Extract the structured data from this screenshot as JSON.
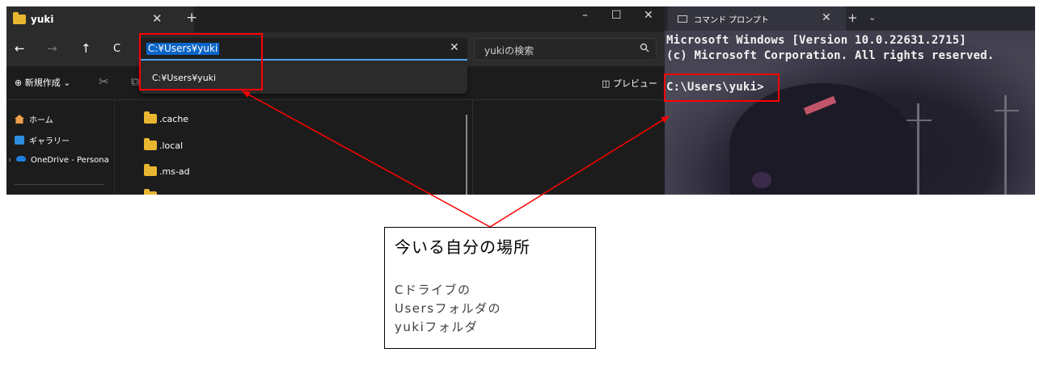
{
  "explorer": {
    "tab_title": "yuki",
    "tab_close": "✕",
    "tab_add": "+",
    "window_controls": {
      "minimize": "–",
      "maximize": "☐",
      "close": "✕"
    },
    "nav": {
      "back": "←",
      "forward": "→",
      "up": "↑",
      "refresh": "C"
    },
    "address": {
      "value": "C:¥Users¥yuki",
      "clear": "✕"
    },
    "search": {
      "placeholder": "yukiの検索",
      "icon": "search-icon"
    },
    "toolbar": {
      "new_label": "⊕ 新規作成 ⌄",
      "cut": "✂",
      "copy": "⧉",
      "preview_label": "◫ プレビュー"
    },
    "dropdown": {
      "item": "C:¥Users¥yuki"
    },
    "sidebar": [
      {
        "label": "ホーム",
        "icon": "home-icon"
      },
      {
        "label": "ギャラリー",
        "icon": "gallery-icon"
      },
      {
        "label": "OneDrive - Persona",
        "icon": "cloud-icon",
        "expander": "›"
      }
    ],
    "files": [
      ".cache",
      ".local",
      ".ms-ad"
    ]
  },
  "cmd": {
    "tab_title": "コマンド プロンプト",
    "tab_close": "✕",
    "tab_add": "+",
    "tab_menu": "⌄",
    "lines": [
      "Microsoft Windows [Version 10.0.22631.2715]",
      "(c) Microsoft Corporation. All rights reserved.",
      "C:\\Users\\yuki>"
    ]
  },
  "annotation": {
    "title": "今いる自分の場所",
    "lines": [
      "Cドライブの",
      "Usersフォルダの",
      "yukiフォルダ"
    ],
    "color": "#ff0000"
  }
}
